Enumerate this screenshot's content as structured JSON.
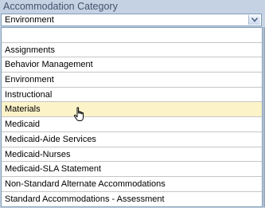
{
  "field": {
    "label": "Accommodation Category",
    "selected_value": "Environment"
  },
  "dropdown": {
    "options": [
      "",
      "Assignments",
      "Behavior Management",
      "Environment",
      "Instructional",
      "Materials",
      "Medicaid",
      "Medicaid-Aide Services",
      "Medicaid-Nurses",
      "Medicaid-SLA Statement",
      "Non-Standard Alternate Accommodations",
      "Standard Accommodations - Assessment"
    ],
    "hovered_option": "Materials"
  },
  "icons": {
    "arrow": "chevron-down-icon",
    "cursor": "hand-pointer-icon"
  },
  "colors": {
    "hover": "#fdf3c9",
    "border": "#7f9db9",
    "header_bg": "#c5d2e4"
  }
}
